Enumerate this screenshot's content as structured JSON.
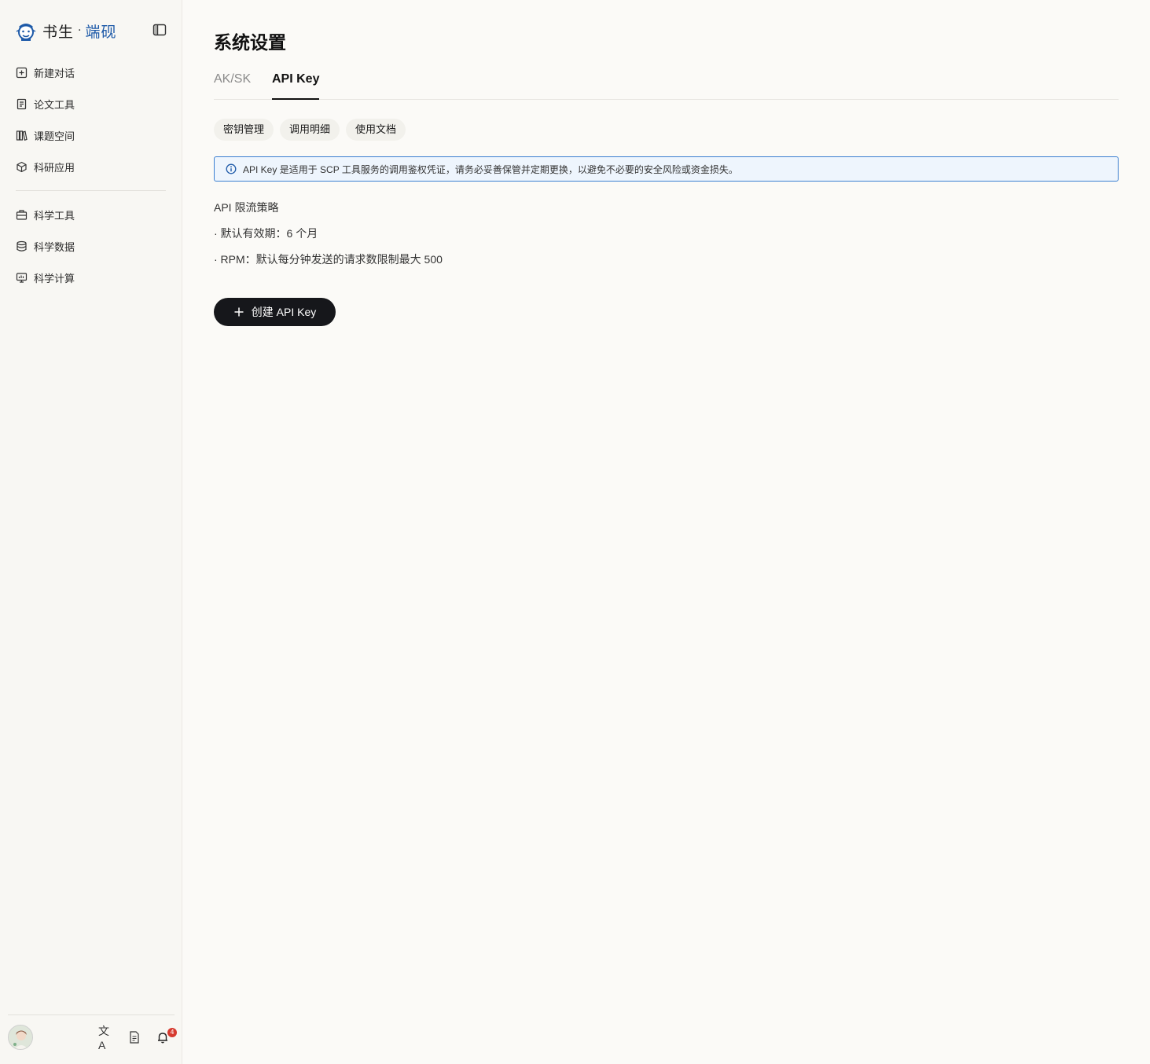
{
  "brand": {
    "name_part1": "书生",
    "separator": "·",
    "name_part2": "端砚"
  },
  "sidebar": {
    "primary_items": [
      {
        "label": "新建对话",
        "icon": "plus-square-icon"
      },
      {
        "label": "论文工具",
        "icon": "document-icon"
      },
      {
        "label": "课题空间",
        "icon": "books-icon"
      },
      {
        "label": "科研应用",
        "icon": "cube-icon"
      }
    ],
    "secondary_items": [
      {
        "label": "科学工具",
        "icon": "toolbox-icon"
      },
      {
        "label": "科学数据",
        "icon": "database-icon"
      },
      {
        "label": "科学计算",
        "icon": "monitor-chart-icon"
      }
    ],
    "footer": {
      "translate_icon_text": "文A",
      "notification_count": "4"
    }
  },
  "main": {
    "title": "系统设置",
    "tabs": [
      {
        "label": "AK/SK",
        "active": false
      },
      {
        "label": "API Key",
        "active": true
      }
    ],
    "subtabs": [
      "密钥管理",
      "调用明细",
      "使用文档"
    ],
    "notice": "API Key 是适用于 SCP 工具服务的调用鉴权凭证，请务必妥善保管并定期更换，以避免不必要的安全风险或资金损失。",
    "policy": {
      "title": "API 限流策略",
      "items": [
        "· 默认有效期：6 个月",
        "· RPM：默认每分钟发送的请求数限制最大 500"
      ]
    },
    "create_button": "创建 API Key"
  },
  "colors": {
    "accent_blue": "#1e5aa8",
    "notice_border": "#3b7fd1",
    "button_dark": "#16171b",
    "badge_red": "#d63a2f"
  }
}
